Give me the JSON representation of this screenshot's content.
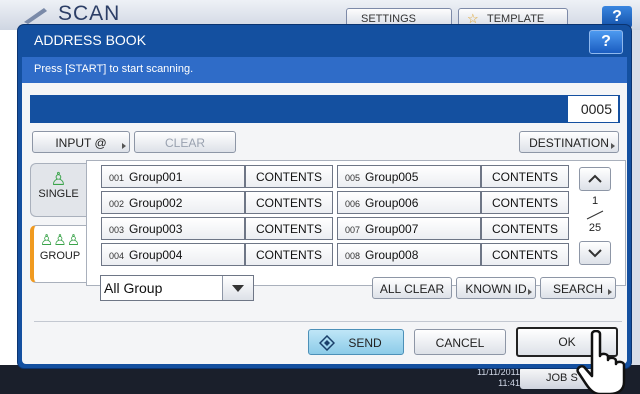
{
  "background": {
    "screen_title": "SCAN",
    "settings_label": "SETTINGS",
    "template_label": "TEMPLATE",
    "help_label": "?",
    "date": "11/11/2011",
    "time": "11:41",
    "job_status_label": "JOB S"
  },
  "dialog": {
    "title": "ADDRESS BOOK",
    "help_label": "?",
    "message": "Press [START] to start scanning.",
    "count": "0005"
  },
  "toolbar": {
    "input_label": "INPUT @",
    "clear_label": "CLEAR",
    "destination_label": "DESTINATION"
  },
  "tabs": {
    "single_label": "SINGLE",
    "group_label": "GROUP"
  },
  "groups": [
    {
      "num": "001",
      "name": "Group001",
      "action": "CONTENTS"
    },
    {
      "num": "002",
      "name": "Group002",
      "action": "CONTENTS"
    },
    {
      "num": "003",
      "name": "Group003",
      "action": "CONTENTS"
    },
    {
      "num": "004",
      "name": "Group004",
      "action": "CONTENTS"
    },
    {
      "num": "005",
      "name": "Group005",
      "action": "CONTENTS"
    },
    {
      "num": "006",
      "name": "Group006",
      "action": "CONTENTS"
    },
    {
      "num": "007",
      "name": "Group007",
      "action": "CONTENTS"
    },
    {
      "num": "008",
      "name": "Group008",
      "action": "CONTENTS"
    }
  ],
  "pager": {
    "current": "1",
    "total": "25"
  },
  "filter": {
    "selected": "All Group"
  },
  "actions": {
    "all_clear_label": "ALL CLEAR",
    "known_id_label": "KNOWN ID",
    "search_label": "SEARCH",
    "send_label": "SEND",
    "cancel_label": "CANCEL",
    "ok_label": "OK"
  },
  "colors": {
    "dialog_blue": "#1450a0",
    "accent_orange": "#f09a20",
    "send_blue": "#8ccbe8"
  }
}
